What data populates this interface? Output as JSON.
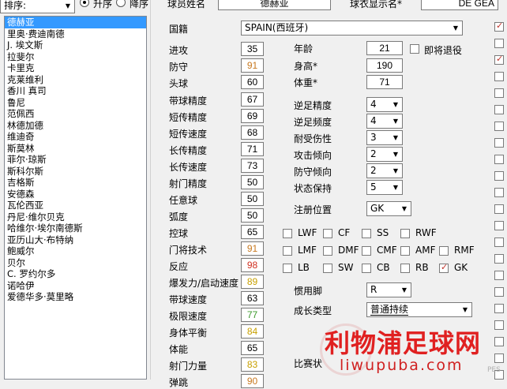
{
  "sort": {
    "label": "排序:",
    "asc_label": "升序",
    "desc_label": "降序"
  },
  "header": {
    "player_name_label": "球员姓名",
    "player_name_value": "德赫亚",
    "shirt_name_label": "球衣显示名*",
    "shirt_name_value": "DE GEA"
  },
  "players": [
    "德赫亚",
    "里奥·费迪南德",
    "J. 埃文斯",
    "拉斐尔",
    "卡里克",
    "克莱维利",
    "香川 真司",
    "鲁尼",
    "范佩西",
    "林德加德",
    "维迪奇",
    "斯莫林",
    "菲尔·琼斯",
    "斯科尔斯",
    "吉格斯",
    "安德森",
    "瓦伦西亚",
    "丹尼·维尔贝克",
    "哈维尔·埃尔南德斯",
    "亚历山大·布特纳",
    "鲍威尔",
    "贝尔",
    "C. 罗约尔多",
    "诺哈伊",
    "爱德华多·莫里略"
  ],
  "nationality": {
    "label": "国籍",
    "value": "SPAIN(西班牙)"
  },
  "stats": [
    {
      "label": "进攻",
      "value": "35",
      "color": "#000000"
    },
    {
      "label": "防守",
      "value": "91",
      "color": "#c8781e"
    },
    {
      "label": "头球",
      "value": "60",
      "color": "#000000"
    },
    {
      "label": "带球精度",
      "value": "67",
      "color": "#000000"
    },
    {
      "label": "短传精度",
      "value": "69",
      "color": "#000000"
    },
    {
      "label": "短传速度",
      "value": "68",
      "color": "#000000"
    },
    {
      "label": "长传精度",
      "value": "71",
      "color": "#000000"
    },
    {
      "label": "长传速度",
      "value": "73",
      "color": "#000000"
    },
    {
      "label": "射门精度",
      "value": "50",
      "color": "#000000"
    },
    {
      "label": "任意球",
      "value": "50",
      "color": "#000000"
    },
    {
      "label": "弧度",
      "value": "50",
      "color": "#000000"
    },
    {
      "label": "控球",
      "value": "65",
      "color": "#000000"
    },
    {
      "label": "门将技术",
      "value": "91",
      "color": "#c8781e"
    },
    {
      "label": "反应",
      "value": "98",
      "color": "#d03020"
    },
    {
      "label": "爆发力/启动速度",
      "value": "89",
      "color": "#c8a000"
    },
    {
      "label": "带球速度",
      "value": "63",
      "color": "#000000"
    },
    {
      "label": "极限速度",
      "value": "77",
      "color": "#3c9a2c"
    },
    {
      "label": "身体平衡",
      "value": "84",
      "color": "#c8a000"
    },
    {
      "label": "体能",
      "value": "65",
      "color": "#000000"
    },
    {
      "label": "射门力量",
      "value": "83",
      "color": "#c8a000"
    },
    {
      "label": "弹跳",
      "value": "90",
      "color": "#c8781e"
    }
  ],
  "physical": {
    "age_label": "年龄",
    "age_value": "21",
    "retire_label": "即将退役",
    "height_label": "身高*",
    "height_value": "190",
    "weight_label": "体重*",
    "weight_value": "71"
  },
  "traits": [
    {
      "label": "逆足精度",
      "value": "4"
    },
    {
      "label": "逆足频度",
      "value": "4"
    },
    {
      "label": "耐受伤性",
      "value": "3"
    },
    {
      "label": "攻击倾向",
      "value": "2"
    },
    {
      "label": "防守倾向",
      "value": "2"
    },
    {
      "label": "状态保持",
      "value": "5"
    }
  ],
  "register_position": {
    "label": "注册位置",
    "value": "GK"
  },
  "positions": [
    {
      "label": "LWF",
      "checked": false
    },
    {
      "label": "CF",
      "checked": false
    },
    {
      "label": "SS",
      "checked": false
    },
    {
      "label": "RWF",
      "checked": false
    },
    {
      "label": "LMF",
      "checked": false
    },
    {
      "label": "DMF",
      "checked": false
    },
    {
      "label": "CMF",
      "checked": false
    },
    {
      "label": "AMF",
      "checked": false
    },
    {
      "label": "RMF",
      "checked": false
    },
    {
      "label": "LB",
      "checked": false
    },
    {
      "label": "SW",
      "checked": false
    },
    {
      "label": "CB",
      "checked": false
    },
    {
      "label": "RB",
      "checked": false
    },
    {
      "label": "GK",
      "checked": true
    }
  ],
  "foot": {
    "label": "惯用脚",
    "value": "R"
  },
  "growth": {
    "label": "成长类型",
    "value": "普通持续"
  },
  "match_label": "比赛状",
  "watermark": {
    "line1": "利物浦足球网",
    "line2": "liwupuba.com",
    "brand": "PES"
  },
  "colors": {
    "selection": "#3399ff",
    "tick_red": "#c0332b",
    "watermark_red": "#e02020"
  }
}
